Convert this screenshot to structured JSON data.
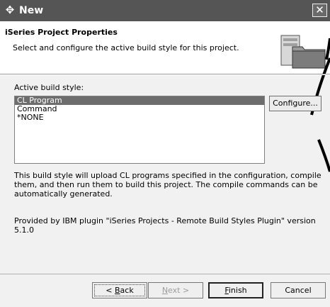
{
  "window": {
    "title": "New",
    "close_label": "✕"
  },
  "header": {
    "title": "iSeries Project Properties",
    "description": "Select and configure the active build style for this project."
  },
  "build_style": {
    "label": "Active build style:",
    "options": [
      "CL Program",
      "Command",
      "*NONE"
    ],
    "selected": "CL Program",
    "configure_label": "Configure..."
  },
  "info": {
    "description": "This build style will upload CL programs specified in the configuration, compile them, and then run them to build this project.  The compile commands can be automatically generated.",
    "provided_by": "Provided by IBM plugin \"iSeries Projects - Remote Build Styles Plugin\" version 5.1.0"
  },
  "buttons": {
    "back_prefix": "< ",
    "back_key": "B",
    "back_rest": "ack",
    "next_key": "N",
    "next_rest": "ext >",
    "finish_key": "F",
    "finish_rest": "inish",
    "cancel": "Cancel"
  },
  "icons": {
    "title": "wizard-new-icon",
    "header": "project-folder-graphic"
  }
}
